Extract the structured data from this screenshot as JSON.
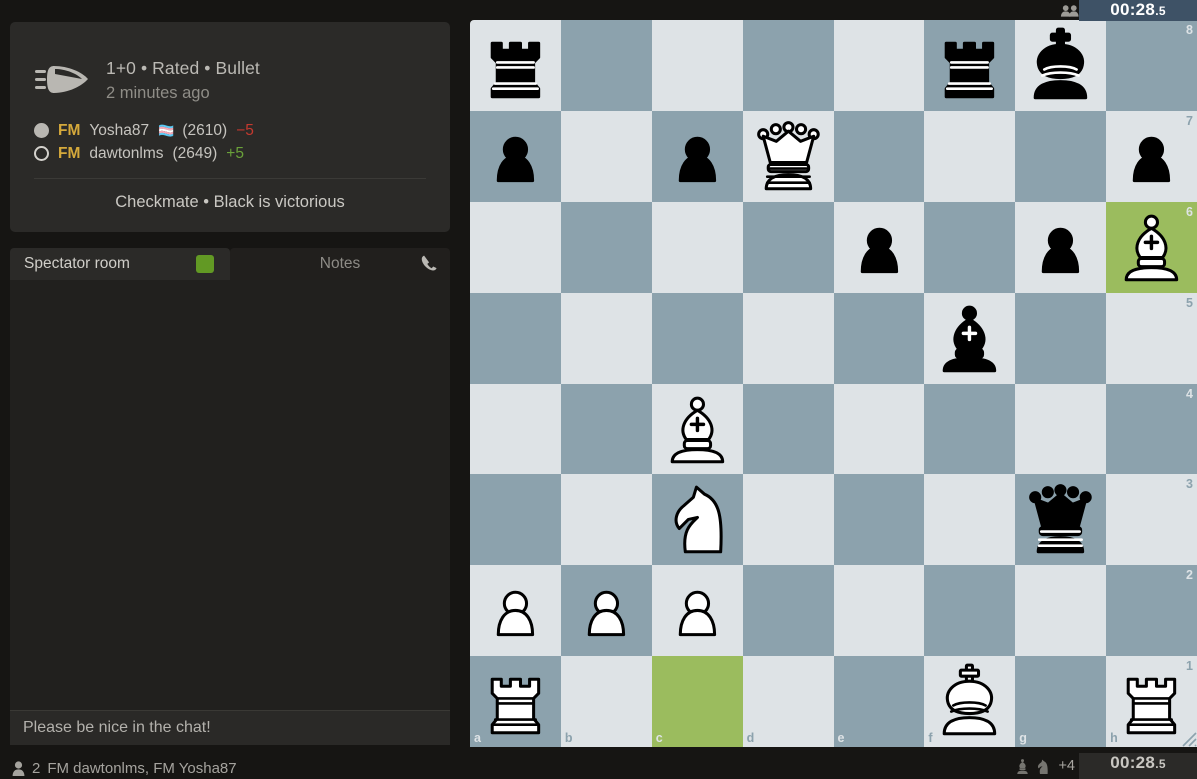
{
  "game_info": {
    "icon": "bullet-icon",
    "time_control": "1+0 • Rated • Bullet",
    "when": "2 minutes ago",
    "players": [
      {
        "color": "white",
        "disc": "white-disc-icon",
        "title": "FM",
        "name": "Yosha87",
        "flag": "🏳️‍⚧️",
        "rating": "(2610)",
        "delta": "−5",
        "delta_sign": "negative"
      },
      {
        "color": "black",
        "disc": "black-disc-icon",
        "title": "FM",
        "name": "dawtonlms",
        "flag": "",
        "rating": "(2649)",
        "delta": "+5",
        "delta_sign": "positive"
      }
    ],
    "result": "Checkmate • Black is victorious"
  },
  "chat": {
    "tabs": [
      {
        "label": "Spectator room",
        "active": true,
        "badge": "room-dot"
      },
      {
        "label": "Notes",
        "active": false,
        "icon": "phone-icon"
      }
    ],
    "messages": [],
    "input_placeholder": "Please be nice in the chat!",
    "watchers_icon": "person-icon",
    "watchers_count": "2",
    "watchers_names": "FM dawtonlms, FM Yosha87"
  },
  "clocks": {
    "top": {
      "minutes_seconds": "00:28",
      "tenths": ".5",
      "active": true
    },
    "bottom": {
      "minutes_seconds": "00:28",
      "tenths": ".5",
      "active": false
    }
  },
  "spectators_icon": "spectators-icon",
  "captured": {
    "pieces": [
      "bishop-icon",
      "knight-icon"
    ],
    "advantage": "+4"
  },
  "colors": {
    "light_square": "#dee3e6",
    "dark_square": "#8ca2ad",
    "highlight": "#9bbc5e",
    "clock_active": "#3e5266",
    "background": "#161513",
    "card": "#2b2a28",
    "title_gold": "#d5a93b",
    "delta_positive": "#6aa13a",
    "delta_negative": "#c4392f",
    "room_dot": "#629924"
  },
  "board": {
    "orientation": "white",
    "files": [
      "a",
      "b",
      "c",
      "d",
      "e",
      "f",
      "g",
      "h"
    ],
    "ranks": [
      "8",
      "7",
      "6",
      "5",
      "4",
      "3",
      "2",
      "1"
    ],
    "highlighted_squares": [
      "h6",
      "c1"
    ],
    "pieces": [
      {
        "square": "a8",
        "color": "black",
        "type": "rook"
      },
      {
        "square": "f8",
        "color": "black",
        "type": "rook"
      },
      {
        "square": "g8",
        "color": "black",
        "type": "king"
      },
      {
        "square": "a7",
        "color": "black",
        "type": "pawn"
      },
      {
        "square": "c7",
        "color": "black",
        "type": "pawn"
      },
      {
        "square": "d7",
        "color": "white",
        "type": "queen"
      },
      {
        "square": "h7",
        "color": "black",
        "type": "pawn"
      },
      {
        "square": "e6",
        "color": "black",
        "type": "pawn"
      },
      {
        "square": "g6",
        "color": "black",
        "type": "pawn"
      },
      {
        "square": "h6",
        "color": "white",
        "type": "bishop"
      },
      {
        "square": "f5",
        "color": "black",
        "type": "bishop"
      },
      {
        "square": "c4",
        "color": "white",
        "type": "bishop"
      },
      {
        "square": "c3",
        "color": "white",
        "type": "knight"
      },
      {
        "square": "g3",
        "color": "black",
        "type": "queen"
      },
      {
        "square": "a2",
        "color": "white",
        "type": "pawn"
      },
      {
        "square": "b2",
        "color": "white",
        "type": "pawn"
      },
      {
        "square": "c2",
        "color": "white",
        "type": "pawn"
      },
      {
        "square": "a1",
        "color": "white",
        "type": "rook"
      },
      {
        "square": "f1",
        "color": "white",
        "type": "king"
      },
      {
        "square": "h1",
        "color": "white",
        "type": "rook"
      }
    ]
  }
}
